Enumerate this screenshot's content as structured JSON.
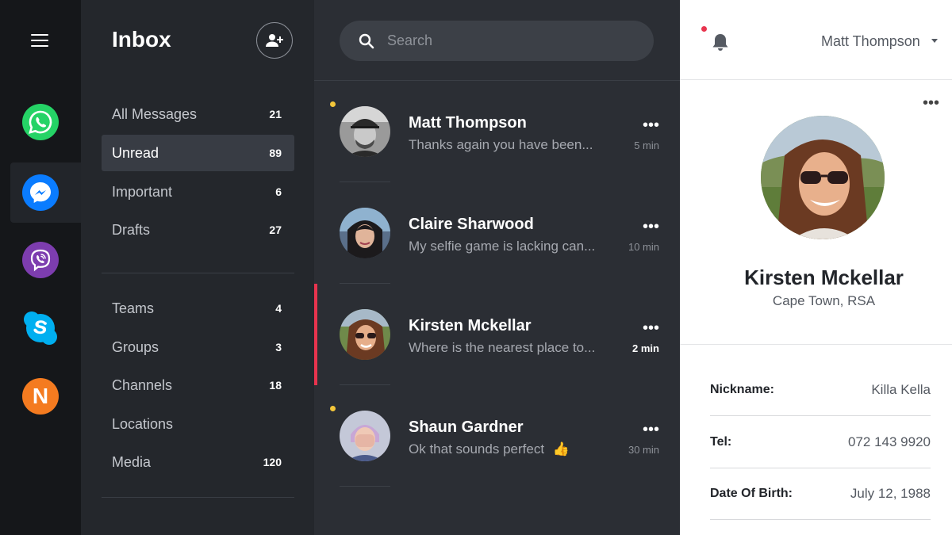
{
  "rail": {
    "apps": [
      {
        "name": "whatsapp",
        "color": "#25d366"
      },
      {
        "name": "messenger",
        "color": "#0a7cff"
      },
      {
        "name": "viber",
        "color": "#7d3daf"
      },
      {
        "name": "skype",
        "color": "#00aff0"
      },
      {
        "name": "n-app",
        "color": "#f47b20"
      }
    ],
    "active_app": "messenger",
    "n_letter": "N"
  },
  "sidebar": {
    "title": "Inbox",
    "primary": [
      {
        "label": "All Messages",
        "count": "21"
      },
      {
        "label": "Unread",
        "count": "89",
        "active": true
      },
      {
        "label": "Important",
        "count": "6"
      },
      {
        "label": "Drafts",
        "count": "27"
      }
    ],
    "secondary": [
      {
        "label": "Teams",
        "count": "4"
      },
      {
        "label": "Groups",
        "count": "3"
      },
      {
        "label": "Channels",
        "count": "18"
      },
      {
        "label": "Locations",
        "count": ""
      },
      {
        "label": "Media",
        "count": "120"
      }
    ]
  },
  "search": {
    "placeholder": "Search",
    "value": ""
  },
  "messages": [
    {
      "name": "Matt Thompson",
      "preview": "Thanks again you have been...",
      "time": "5 min",
      "unread": true
    },
    {
      "name": "Claire Sharwood",
      "preview": "My selfie game is lacking can...",
      "time": "10 min",
      "unread": false
    },
    {
      "name": "Kirsten Mckellar",
      "preview": "Where is the nearest place to...",
      "time": "2 min",
      "unread": false,
      "selected": true
    },
    {
      "name": "Shaun Gardner",
      "preview": "Ok that sounds perfect",
      "time": "30 min",
      "unread": true,
      "emoji": "👍"
    }
  ],
  "header": {
    "user_name": "Matt Thompson"
  },
  "profile": {
    "name": "Kirsten Mckellar",
    "location": "Cape Town, RSA",
    "fields": [
      {
        "label": "Nickname:",
        "value": "Killa Kella"
      },
      {
        "label": "Tel:",
        "value": "072 143 9920"
      },
      {
        "label": "Date Of Birth:",
        "value": "July 12, 1988"
      }
    ]
  },
  "colors": {
    "accent": "#e8344e",
    "unread_dot": "#f3c63a",
    "rail_bg": "#15171a",
    "sidebar_bg": "#24272c",
    "list_bg": "#2b2e34"
  },
  "icons": {
    "menu": "hamburger-icon",
    "add_user": "add-user-icon",
    "search": "search-icon",
    "bell": "bell-icon",
    "more": "more-dots-icon",
    "caret": "caret-down-icon"
  }
}
